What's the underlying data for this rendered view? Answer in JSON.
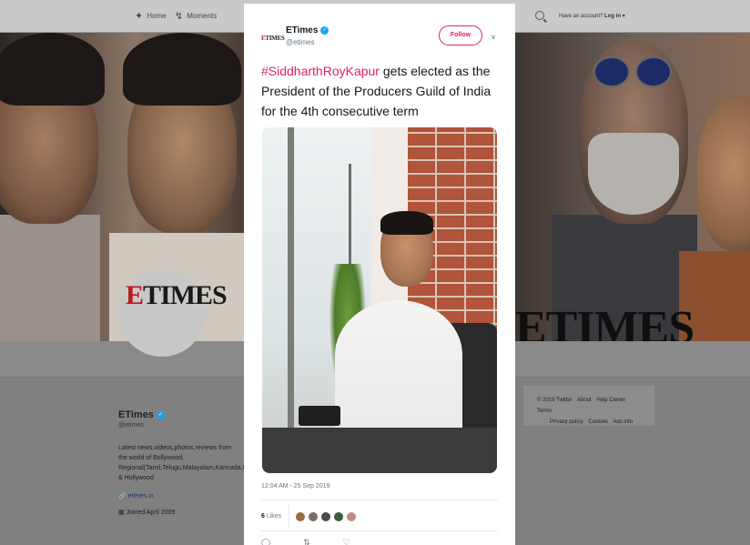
{
  "topnav": {
    "home_label": "Home",
    "home_icon": "twitter-bird-icon",
    "moments_label": "Moments",
    "moments_icon": "lightning-icon",
    "search_icon": "search-icon",
    "login_prompt": "Have an account?",
    "login_label": "Log in"
  },
  "banner": {
    "logo_left": "ETIMES",
    "logo_right": "ETIMES"
  },
  "profile": {
    "name": "ETimes",
    "handle": "@etimes",
    "bio": "Latest news,videos,photos,reviews from the world of Bollywood, Regional(Tamil,Telugu,Malayalam,Kannada,Bengali,Bhojpuri,Marathi,Punjabi,Gujarati) & Hollywood",
    "link": "etimes.in",
    "joined": "Joined April 2009"
  },
  "footer": {
    "links": [
      "© 2019 Twitter",
      "About",
      "Help Center",
      "Terms",
      "Privacy policy",
      "Cookies",
      "Ads info"
    ]
  },
  "tweet": {
    "avatar_text": "ETIMES",
    "author_name": "ETimes",
    "author_handle": "@etimes",
    "follow_label": "Follow",
    "hashtag": "#SiddharthRoyKapur",
    "text": " gets elected as the President of the Producers Guild of India for the 4th consecutive term",
    "timestamp": "12:04 AM - 25 Sep 2019",
    "likes_count": "6",
    "likes_label": "Likes",
    "colors": {
      "accent": "#e0245e",
      "verified": "#1da1f2"
    }
  }
}
